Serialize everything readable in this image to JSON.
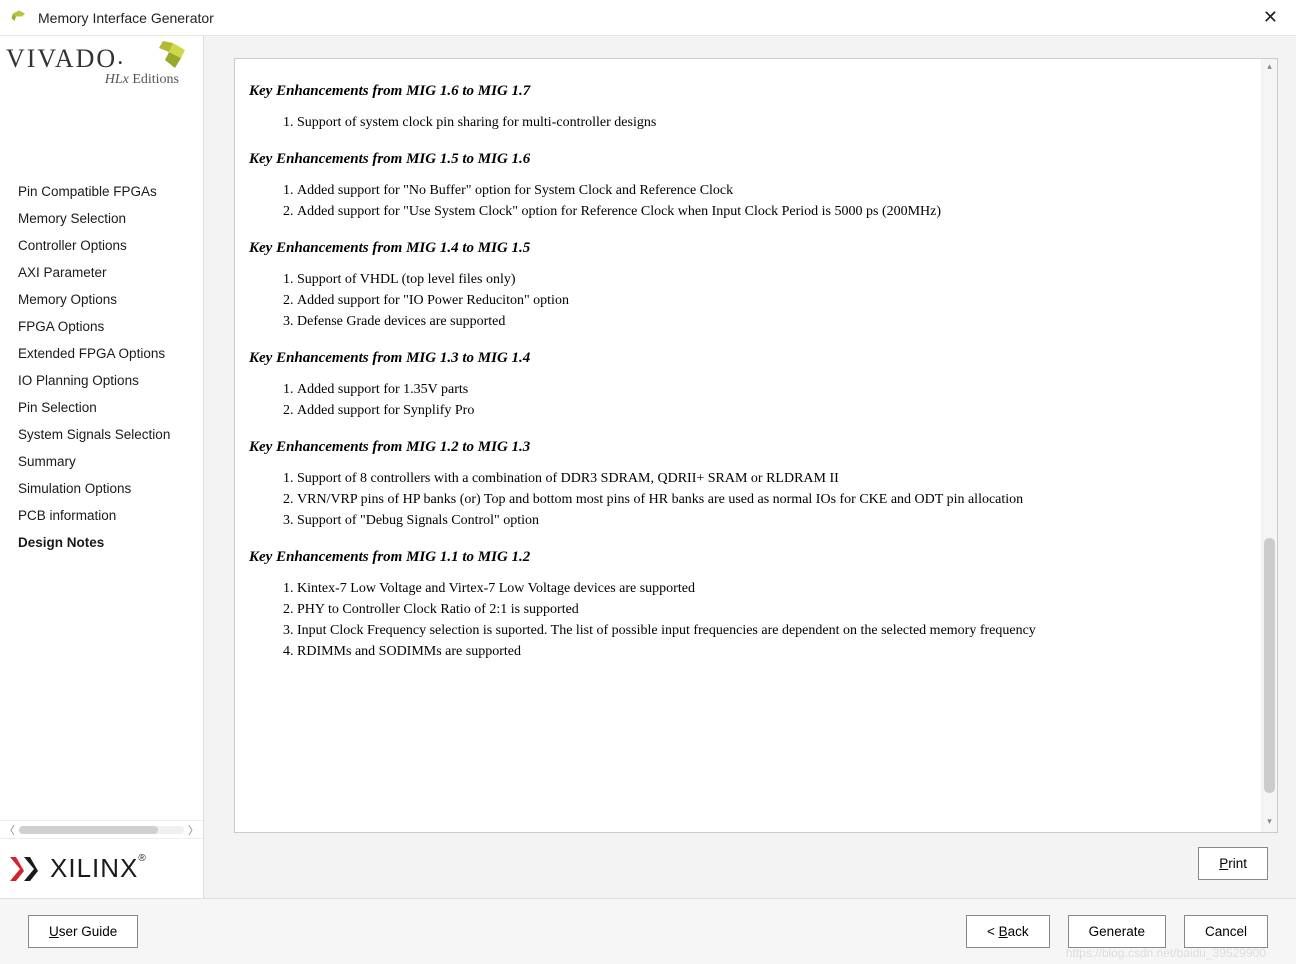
{
  "window": {
    "title": "Memory Interface Generator"
  },
  "logo": {
    "brand": "VIVADO",
    "edition": "HLx Editions"
  },
  "nav": {
    "items": [
      {
        "label": "Pin Compatible FPGAs",
        "active": false
      },
      {
        "label": "Memory Selection",
        "active": false
      },
      {
        "label": "Controller Options",
        "active": false
      },
      {
        "label": "AXI Parameter",
        "active": false
      },
      {
        "label": "Memory Options",
        "active": false
      },
      {
        "label": "FPGA Options",
        "active": false
      },
      {
        "label": "Extended FPGA Options",
        "active": false
      },
      {
        "label": "IO Planning Options",
        "active": false
      },
      {
        "label": "Pin Selection",
        "active": false
      },
      {
        "label": "System Signals Selection",
        "active": false
      },
      {
        "label": "Summary",
        "active": false
      },
      {
        "label": "Simulation Options",
        "active": false
      },
      {
        "label": "PCB information",
        "active": false
      },
      {
        "label": "Design Notes",
        "active": true
      }
    ]
  },
  "footer_logo": "XILINX",
  "doc": {
    "sections": [
      {
        "heading": "Key Enhancements from MIG 1.6 to MIG 1.7",
        "items": [
          "Support of system clock pin sharing for multi-controller designs"
        ]
      },
      {
        "heading": "Key Enhancements from MIG 1.5 to MIG 1.6",
        "items": [
          "Added support for \"No Buffer\" option for System Clock and Reference Clock",
          "Added support for \"Use System Clock\" option for Reference Clock when Input Clock Period is 5000 ps (200MHz)"
        ]
      },
      {
        "heading": "Key Enhancements from MIG 1.4 to MIG 1.5",
        "items": [
          "Support of VHDL (top level files only)",
          "Added support for \"IO Power Reduciton\" option",
          "Defense Grade devices are supported"
        ]
      },
      {
        "heading": "Key Enhancements from MIG 1.3 to MIG 1.4",
        "items": [
          "Added support for 1.35V parts",
          "Added support for Synplify Pro"
        ]
      },
      {
        "heading": "Key Enhancements from MIG 1.2 to MIG 1.3",
        "items": [
          "Support of 8 controllers with a combination of DDR3 SDRAM, QDRII+ SRAM or RLDRAM II",
          "VRN/VRP pins of HP banks (or) Top and bottom most pins of HR banks are used as normal IOs for CKE and ODT pin allocation",
          "Support of \"Debug Signals Control\" option"
        ]
      },
      {
        "heading": "Key Enhancements from MIG 1.1 to MIG 1.2",
        "items": [
          "Kintex-7 Low Voltage and Virtex-7 Low Voltage devices are supported",
          "PHY to Controller Clock Ratio of 2:1 is supported",
          "Input Clock Frequency selection is suported. The list of possible input frequencies are dependent on the selected memory frequency",
          "RDIMMs and SODIMMs are supported"
        ]
      }
    ]
  },
  "buttons": {
    "print": "Print",
    "user_guide": "User Guide",
    "back": "< Back",
    "generate": "Generate",
    "cancel": "Cancel"
  },
  "watermark": "https://blog.csdn.net/baidu_39529900"
}
